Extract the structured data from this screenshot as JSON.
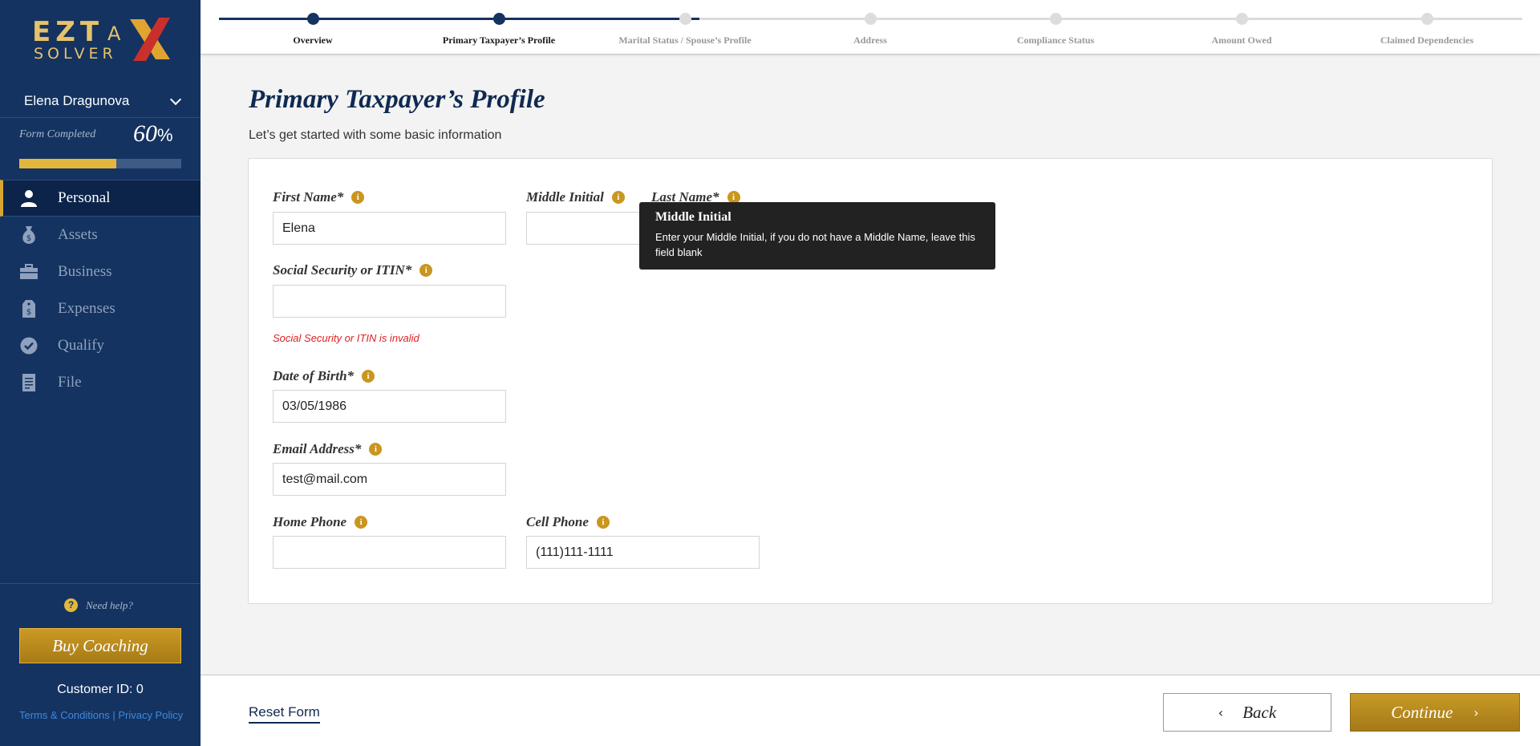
{
  "brand": {
    "logo_text_top": "EZT",
    "logo_text_a": "A",
    "logo_text_bottom": "SOLVER",
    "gold": "#e3b63d",
    "navy": "#143361"
  },
  "sidebar": {
    "user_name": "Elena Dragunova",
    "form_completed_label": "Form Completed",
    "progress_value": "60",
    "progress_unit": "%",
    "progress_fraction": 0.6,
    "nav": [
      {
        "label": "Personal",
        "icon": "person-icon",
        "active": true
      },
      {
        "label": "Assets",
        "icon": "money-bag-icon",
        "active": false
      },
      {
        "label": "Business",
        "icon": "briefcase-icon",
        "active": false
      },
      {
        "label": "Expenses",
        "icon": "price-tag-icon",
        "active": false
      },
      {
        "label": "Qualify",
        "icon": "check-circle-icon",
        "active": false
      },
      {
        "label": "File",
        "icon": "document-icon",
        "active": false
      }
    ],
    "help_text": "Need help?",
    "coaching_button": "Buy Coaching",
    "customer_id": "Customer ID: 0",
    "terms": "Terms & Conditions",
    "separator": " | ",
    "privacy": "Privacy Policy"
  },
  "stepper": {
    "steps": [
      {
        "label": "Overview",
        "done": true
      },
      {
        "label": "Primary Taxpayer’s Profile",
        "done": true
      },
      {
        "label": "Marital Status / Spouse’s Profile",
        "done": false
      },
      {
        "label": "Address",
        "done": false
      },
      {
        "label": "Compliance Status",
        "done": false
      },
      {
        "label": "Amount Owed",
        "done": false
      },
      {
        "label": "Claimed Dependencies",
        "done": false
      }
    ]
  },
  "main": {
    "title": "Primary Taxpayer’s Profile",
    "subtitle": "Let’s get started with some basic information",
    "fields": {
      "first_name": {
        "label": "First Name*",
        "value": "Elena",
        "placeholder": ""
      },
      "middle_initial": {
        "label": "Middle Initial",
        "value": "",
        "placeholder": ""
      },
      "last_name": {
        "label": "Last Name*",
        "value": "",
        "placeholder": ""
      },
      "ssn": {
        "label": "Social Security or ITIN*",
        "value": "",
        "placeholder": "",
        "error": "Social Security or ITIN is invalid"
      },
      "dob": {
        "label": "Date of Birth*",
        "value": "03/05/1986",
        "placeholder": ""
      },
      "email": {
        "label": "Email Address*",
        "value": "test@mail.com",
        "placeholder": ""
      },
      "home_phone": {
        "label": "Home Phone",
        "value": "",
        "placeholder": ""
      },
      "cell_phone": {
        "label": "Cell Phone",
        "value": "(111)111-1111",
        "placeholder": ""
      }
    },
    "info_glyph": "i",
    "tooltip": {
      "title": "Middle Initial",
      "body": "Enter your Middle Initial, if you do not have a Middle Name, leave this field blank"
    }
  },
  "footer": {
    "reset": "Reset Form",
    "back": "Back",
    "continue": "Continue",
    "back_arrow": "‹",
    "continue_arrow": "›"
  }
}
